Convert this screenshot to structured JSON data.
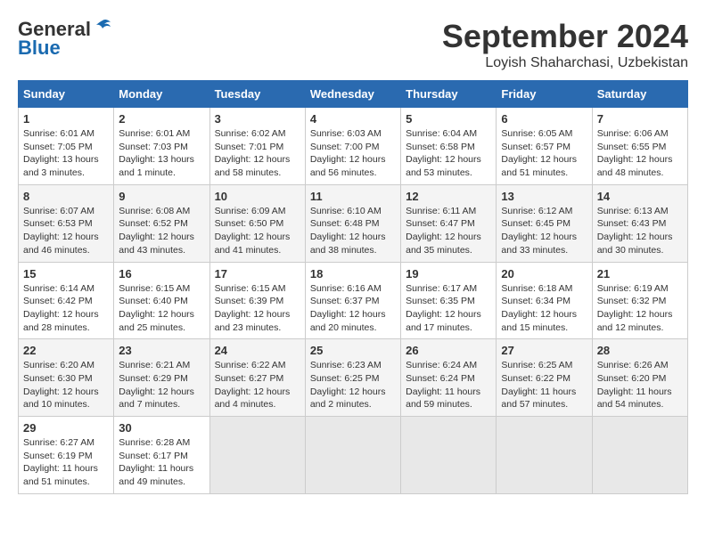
{
  "header": {
    "logo_general": "General",
    "logo_blue": "Blue",
    "month_title": "September 2024",
    "location": "Loyish Shaharchasi, Uzbekistan"
  },
  "days_of_week": [
    "Sunday",
    "Monday",
    "Tuesday",
    "Wednesday",
    "Thursday",
    "Friday",
    "Saturday"
  ],
  "weeks": [
    [
      {
        "day": "1",
        "sunrise": "6:01 AM",
        "sunset": "7:05 PM",
        "daylight": "13 hours and 3 minutes."
      },
      {
        "day": "2",
        "sunrise": "6:01 AM",
        "sunset": "7:03 PM",
        "daylight": "13 hours and 1 minute."
      },
      {
        "day": "3",
        "sunrise": "6:02 AM",
        "sunset": "7:01 PM",
        "daylight": "12 hours and 58 minutes."
      },
      {
        "day": "4",
        "sunrise": "6:03 AM",
        "sunset": "7:00 PM",
        "daylight": "12 hours and 56 minutes."
      },
      {
        "day": "5",
        "sunrise": "6:04 AM",
        "sunset": "6:58 PM",
        "daylight": "12 hours and 53 minutes."
      },
      {
        "day": "6",
        "sunrise": "6:05 AM",
        "sunset": "6:57 PM",
        "daylight": "12 hours and 51 minutes."
      },
      {
        "day": "7",
        "sunrise": "6:06 AM",
        "sunset": "6:55 PM",
        "daylight": "12 hours and 48 minutes."
      }
    ],
    [
      {
        "day": "8",
        "sunrise": "6:07 AM",
        "sunset": "6:53 PM",
        "daylight": "12 hours and 46 minutes."
      },
      {
        "day": "9",
        "sunrise": "6:08 AM",
        "sunset": "6:52 PM",
        "daylight": "12 hours and 43 minutes."
      },
      {
        "day": "10",
        "sunrise": "6:09 AM",
        "sunset": "6:50 PM",
        "daylight": "12 hours and 41 minutes."
      },
      {
        "day": "11",
        "sunrise": "6:10 AM",
        "sunset": "6:48 PM",
        "daylight": "12 hours and 38 minutes."
      },
      {
        "day": "12",
        "sunrise": "6:11 AM",
        "sunset": "6:47 PM",
        "daylight": "12 hours and 35 minutes."
      },
      {
        "day": "13",
        "sunrise": "6:12 AM",
        "sunset": "6:45 PM",
        "daylight": "12 hours and 33 minutes."
      },
      {
        "day": "14",
        "sunrise": "6:13 AM",
        "sunset": "6:43 PM",
        "daylight": "12 hours and 30 minutes."
      }
    ],
    [
      {
        "day": "15",
        "sunrise": "6:14 AM",
        "sunset": "6:42 PM",
        "daylight": "12 hours and 28 minutes."
      },
      {
        "day": "16",
        "sunrise": "6:15 AM",
        "sunset": "6:40 PM",
        "daylight": "12 hours and 25 minutes."
      },
      {
        "day": "17",
        "sunrise": "6:15 AM",
        "sunset": "6:39 PM",
        "daylight": "12 hours and 23 minutes."
      },
      {
        "day": "18",
        "sunrise": "6:16 AM",
        "sunset": "6:37 PM",
        "daylight": "12 hours and 20 minutes."
      },
      {
        "day": "19",
        "sunrise": "6:17 AM",
        "sunset": "6:35 PM",
        "daylight": "12 hours and 17 minutes."
      },
      {
        "day": "20",
        "sunrise": "6:18 AM",
        "sunset": "6:34 PM",
        "daylight": "12 hours and 15 minutes."
      },
      {
        "day": "21",
        "sunrise": "6:19 AM",
        "sunset": "6:32 PM",
        "daylight": "12 hours and 12 minutes."
      }
    ],
    [
      {
        "day": "22",
        "sunrise": "6:20 AM",
        "sunset": "6:30 PM",
        "daylight": "12 hours and 10 minutes."
      },
      {
        "day": "23",
        "sunrise": "6:21 AM",
        "sunset": "6:29 PM",
        "daylight": "12 hours and 7 minutes."
      },
      {
        "day": "24",
        "sunrise": "6:22 AM",
        "sunset": "6:27 PM",
        "daylight": "12 hours and 4 minutes."
      },
      {
        "day": "25",
        "sunrise": "6:23 AM",
        "sunset": "6:25 PM",
        "daylight": "12 hours and 2 minutes."
      },
      {
        "day": "26",
        "sunrise": "6:24 AM",
        "sunset": "6:24 PM",
        "daylight": "11 hours and 59 minutes."
      },
      {
        "day": "27",
        "sunrise": "6:25 AM",
        "sunset": "6:22 PM",
        "daylight": "11 hours and 57 minutes."
      },
      {
        "day": "28",
        "sunrise": "6:26 AM",
        "sunset": "6:20 PM",
        "daylight": "11 hours and 54 minutes."
      }
    ],
    [
      {
        "day": "29",
        "sunrise": "6:27 AM",
        "sunset": "6:19 PM",
        "daylight": "11 hours and 51 minutes."
      },
      {
        "day": "30",
        "sunrise": "6:28 AM",
        "sunset": "6:17 PM",
        "daylight": "11 hours and 49 minutes."
      },
      null,
      null,
      null,
      null,
      null
    ]
  ]
}
